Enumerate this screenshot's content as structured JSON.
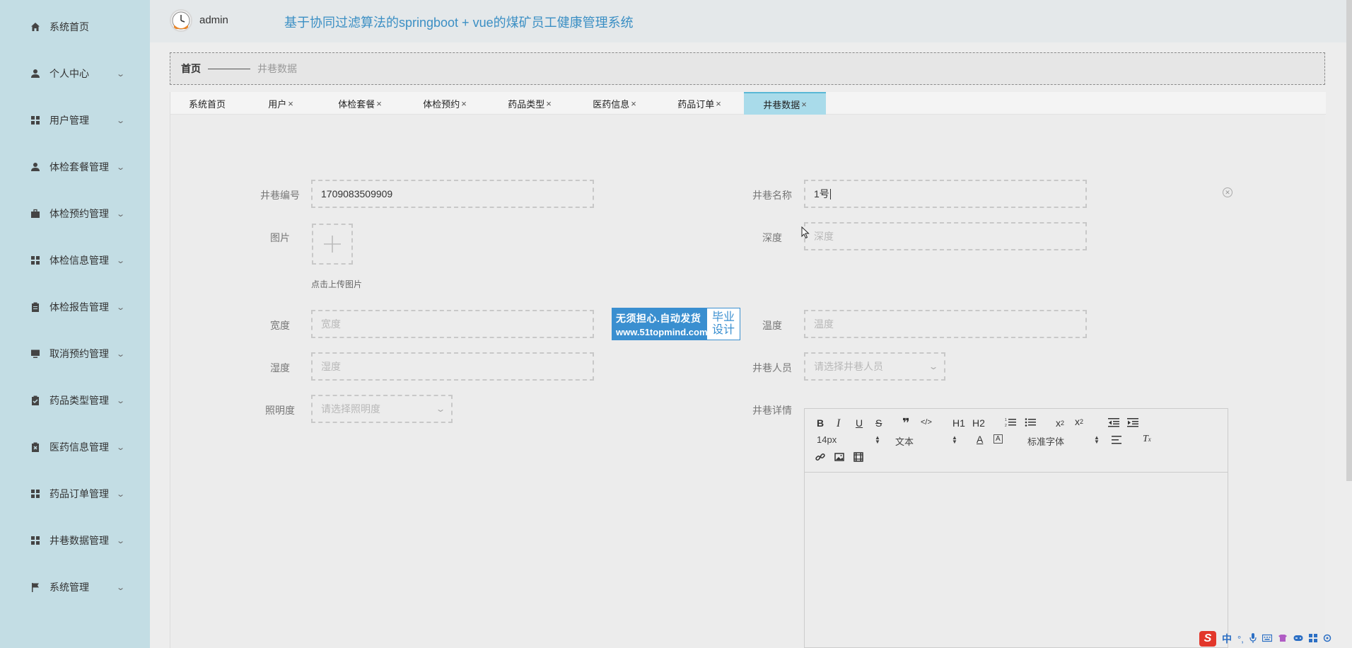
{
  "sidebar": {
    "items": [
      {
        "label": "系统首页",
        "icon": "home-icon",
        "has_arrow": false
      },
      {
        "label": "个人中心",
        "icon": "person-icon",
        "has_arrow": true
      },
      {
        "label": "用户管理",
        "icon": "grid-icon",
        "has_arrow": true
      },
      {
        "label": "体检套餐管理",
        "icon": "person-icon",
        "has_arrow": true
      },
      {
        "label": "体检预约管理",
        "icon": "briefcase-icon",
        "has_arrow": true
      },
      {
        "label": "体检信息管理",
        "icon": "grid-icon",
        "has_arrow": true
      },
      {
        "label": "体检报告管理",
        "icon": "clipboard-icon",
        "has_arrow": true
      },
      {
        "label": "取消预约管理",
        "icon": "monitor-icon",
        "has_arrow": true
      },
      {
        "label": "药品类型管理",
        "icon": "check-clipboard-icon",
        "has_arrow": true
      },
      {
        "label": "医药信息管理",
        "icon": "x-clipboard-icon",
        "has_arrow": true
      },
      {
        "label": "药品订单管理",
        "icon": "grid-icon",
        "has_arrow": true
      },
      {
        "label": "井巷数据管理",
        "icon": "grid-icon",
        "has_arrow": true
      },
      {
        "label": "系统管理",
        "icon": "flag-icon",
        "has_arrow": true
      }
    ]
  },
  "header": {
    "username": "admin",
    "title": "基于协同过滤算法的springboot + vue的煤矿员工健康管理系统"
  },
  "breadcrumb": {
    "home": "首页",
    "current": "井巷数据"
  },
  "tabs": [
    {
      "label": "系统首页",
      "closable": false,
      "active": false
    },
    {
      "label": "用户",
      "closable": true,
      "active": false
    },
    {
      "label": "体检套餐",
      "closable": true,
      "active": false
    },
    {
      "label": "体检预约",
      "closable": true,
      "active": false
    },
    {
      "label": "药品类型",
      "closable": true,
      "active": false
    },
    {
      "label": "医药信息",
      "closable": true,
      "active": false
    },
    {
      "label": "药品订单",
      "closable": true,
      "active": false
    },
    {
      "label": "井巷数据",
      "closable": true,
      "active": true
    }
  ],
  "tab_close_glyph": "×",
  "form": {
    "shaft_no": {
      "label": "井巷编号",
      "value": "1709083509909"
    },
    "shaft_name": {
      "label": "井巷名称",
      "value": "1号"
    },
    "image": {
      "label": "图片",
      "hint": "点击上传图片"
    },
    "depth": {
      "label": "深度",
      "placeholder": "深度"
    },
    "width": {
      "label": "宽度",
      "placeholder": "宽度"
    },
    "temperature": {
      "label": "温度",
      "placeholder": "温度"
    },
    "humidity": {
      "label": "湿度",
      "placeholder": "湿度"
    },
    "staff": {
      "label": "井巷人员",
      "placeholder": "请选择井巷人员"
    },
    "illumination": {
      "label": "照明度",
      "placeholder": "请选择照明度"
    },
    "detail": {
      "label": "井巷详情"
    }
  },
  "editor": {
    "font_size": "14px",
    "paragraph": "文本",
    "font_family": "标准字体",
    "h1": "H1",
    "h2": "H2"
  },
  "badge": {
    "line1": "无须担心.自动发货",
    "line2": "www.51topmind.com",
    "right1": "毕业",
    "right2": "设计"
  },
  "ime": {
    "lang": "中"
  },
  "colors": {
    "sidebar_bg": "#c3dde4",
    "accent": "#3b8fc4",
    "active_tab": "#a9dbea"
  }
}
